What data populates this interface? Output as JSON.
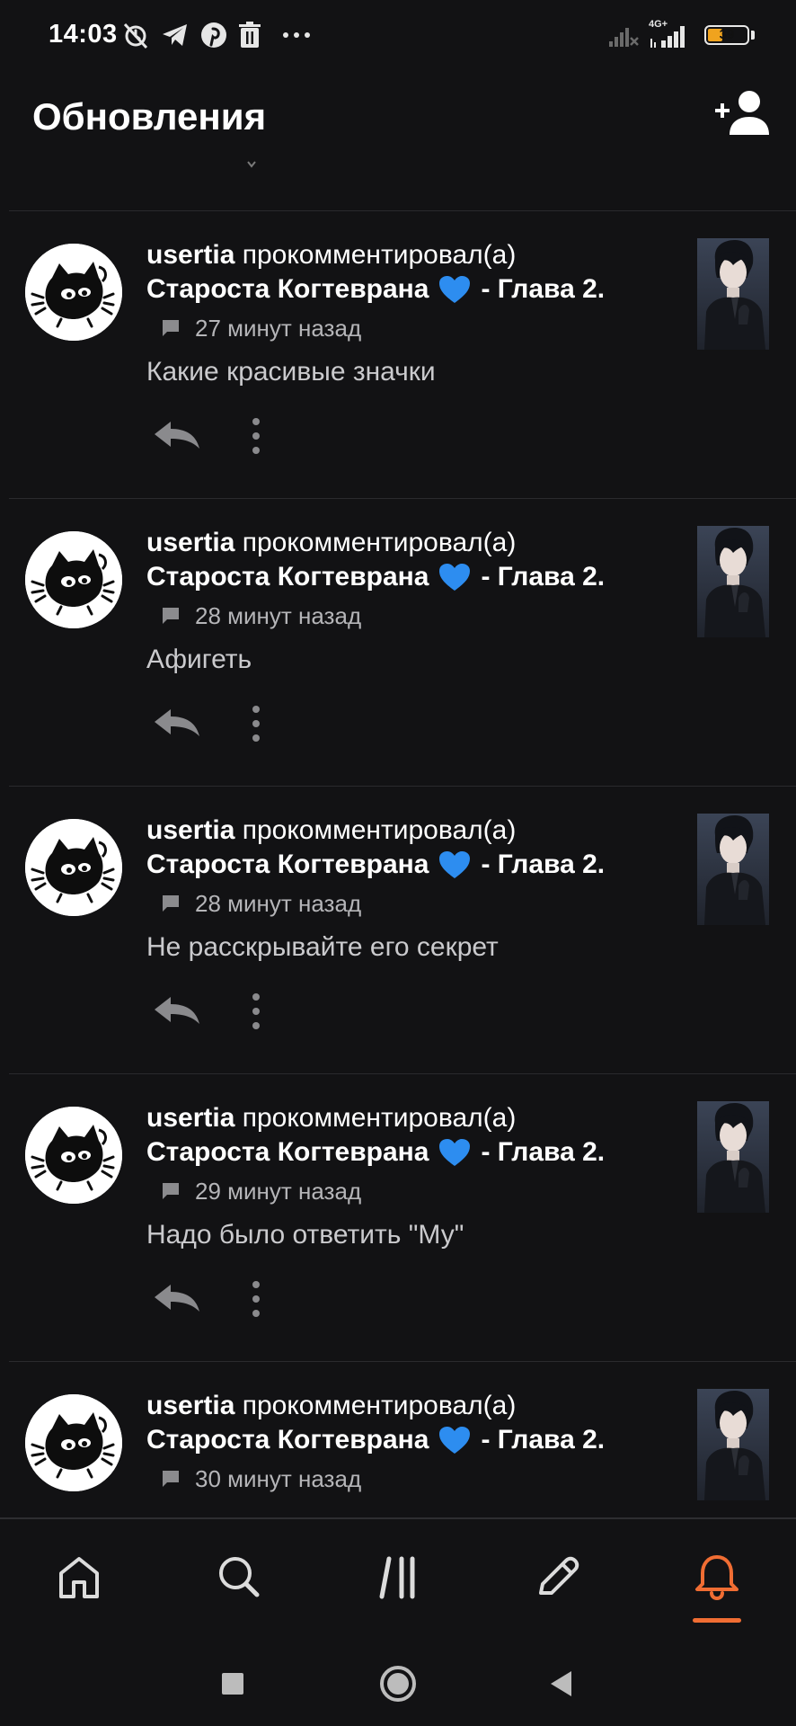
{
  "status_bar": {
    "time": "14:03",
    "battery": "39",
    "battery_level": 0.39,
    "network": "4G+",
    "icons": [
      "alarm-off-icon",
      "telegram-icon",
      "pinterest-icon",
      "trash-icon",
      "more-dots-icon",
      "signal-weak-icon",
      "signal-icon",
      "battery-icon"
    ]
  },
  "header": {
    "title": "Обновления",
    "add_user_icon": "add-user-icon"
  },
  "feed": {
    "items": [
      {
        "username": "usertia",
        "action": "прокомментировал(а)",
        "work_title": "Староста Когтеврана",
        "chapter": "- Глава 2.",
        "time": "27 минут назад",
        "comment": "Какие красивые значки"
      },
      {
        "username": "usertia",
        "action": "прокомментировал(а)",
        "work_title": "Староста Когтеврана",
        "chapter": "- Глава 2.",
        "time": "28 минут назад",
        "comment": "Афигеть"
      },
      {
        "username": "usertia",
        "action": "прокомментировал(а)",
        "work_title": "Староста Когтеврана",
        "chapter": "- Глава 2.",
        "time": "28 минут назад",
        "comment": "Не расскрывайте его секрет"
      },
      {
        "username": "usertia",
        "action": "прокомментировал(а)",
        "work_title": "Староста Когтеврана",
        "chapter": "- Глава 2.",
        "time": "29 минут назад",
        "comment": "Надо было ответить \"Му\""
      },
      {
        "username": "usertia",
        "action": "прокомментировал(а)",
        "work_title": "Староста Когтеврана",
        "chapter": "- Глава 2.",
        "time": "30 минут назад",
        "comment": ""
      }
    ]
  },
  "bottom_nav": {
    "items": [
      "home-icon",
      "search-icon",
      "library-icon",
      "pencil-icon",
      "bell-icon"
    ],
    "active": "bell-icon",
    "accent": "#f06d33"
  },
  "system_nav": [
    "square-icon",
    "circle-icon",
    "back-triangle-icon"
  ],
  "colors": {
    "background": "#121214",
    "heart": "#2d8df0",
    "accent": "#f06d33"
  }
}
